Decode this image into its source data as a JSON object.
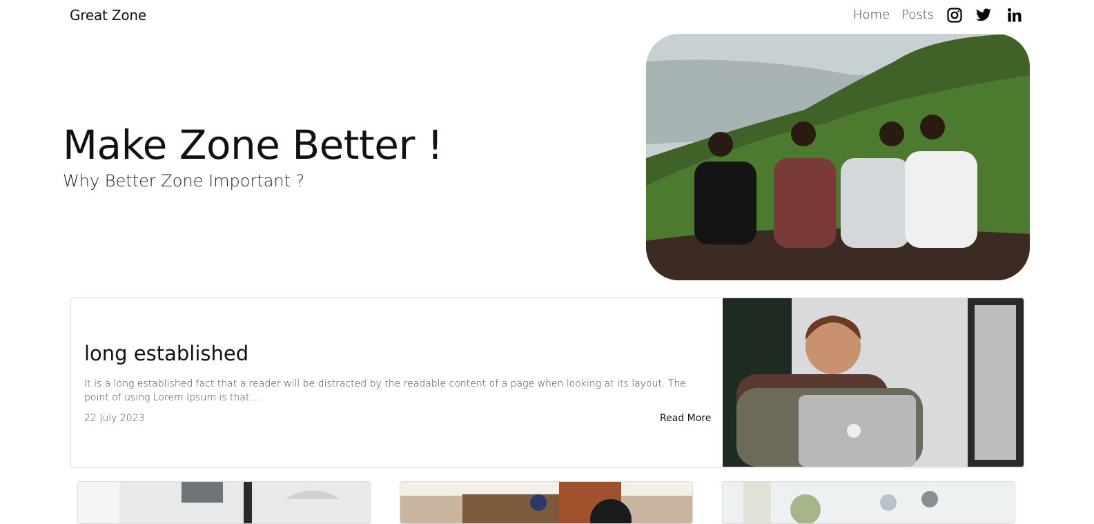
{
  "nav": {
    "brand": "Great Zone",
    "links": [
      {
        "label": "Home"
      },
      {
        "label": "Posts"
      }
    ],
    "social_icons": [
      "instagram-icon",
      "twitter-icon",
      "linkedin-icon"
    ]
  },
  "hero": {
    "title": "Make Zone Better !",
    "subtitle": "Why Better Zone Important ?"
  },
  "featured_post": {
    "title": "long established",
    "excerpt": "It is a long established fact that a reader will be distracted by the readable content of a page when looking at its layout. The point of using Lorem Ipsum is that....",
    "date": "22 July 2023",
    "read_more": "Read More"
  },
  "colors": {
    "text": "#111111",
    "card_border": "#dcdcdc",
    "background": "#ffffff"
  }
}
